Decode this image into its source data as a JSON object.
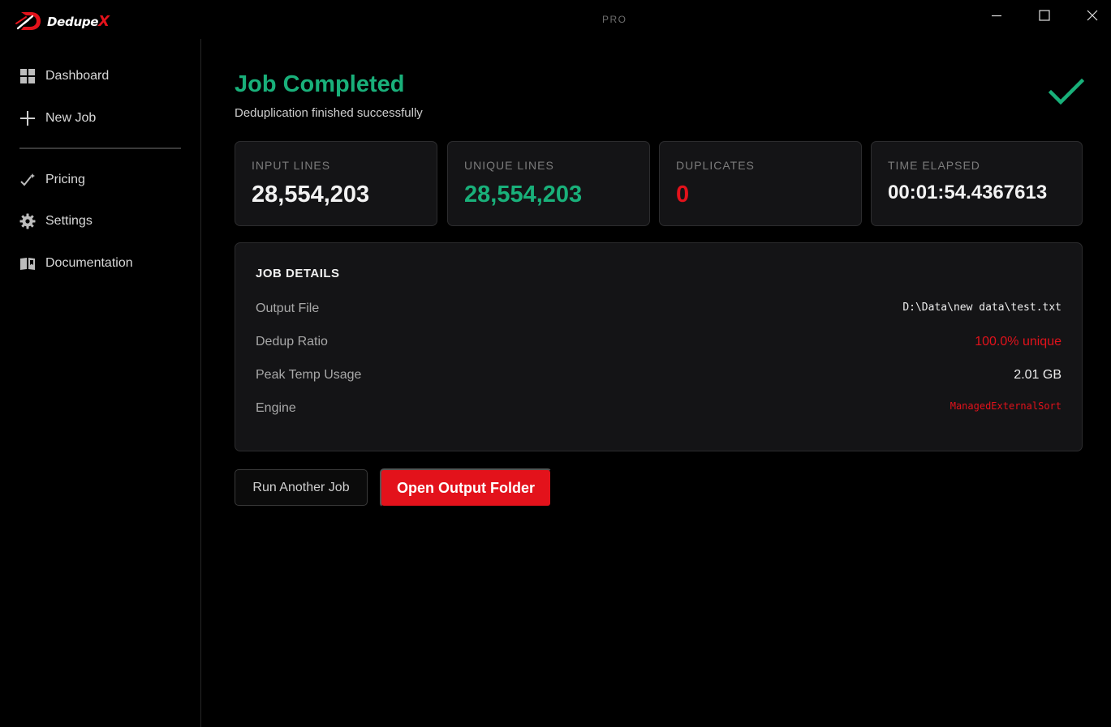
{
  "app": {
    "brand": "Dedupe",
    "brand_x": "X",
    "tier": "PRO"
  },
  "colors": {
    "accent": "#e3121b",
    "success": "#19b07a",
    "background": "#000000",
    "card": "#141416"
  },
  "window_controls": [
    "minimize-icon",
    "maximize-icon",
    "close-icon"
  ],
  "sidebar": {
    "items": [
      {
        "label": "Dashboard",
        "icon": "grid-icon"
      },
      {
        "label": "New Job",
        "icon": "plus-icon"
      },
      {
        "label": "Pricing",
        "icon": "check-sparkle-icon"
      },
      {
        "label": "Settings",
        "icon": "gear-icon"
      },
      {
        "label": "Documentation",
        "icon": "book-icon"
      }
    ]
  },
  "main": {
    "title": "Job Completed",
    "subtitle": "Deduplication finished successfully",
    "status_icon": "checkmark-icon",
    "stats": [
      {
        "label": "INPUT LINES",
        "value": "28,554,203",
        "color": "#f2f2f2"
      },
      {
        "label": "UNIQUE LINES",
        "value": "28,554,203",
        "color": "#19b07a"
      },
      {
        "label": "DUPLICATES",
        "value": "0",
        "color": "#e3121b"
      },
      {
        "label": "TIME ELAPSED",
        "value": "00:01:54.4367613",
        "color": "#f2f2f2"
      }
    ],
    "details": {
      "title": "JOB DETAILS",
      "rows": [
        {
          "key": "Output File",
          "value": "D:\\Data\\new data\\test.txt"
        },
        {
          "key": "Dedup Ratio",
          "value": "100.0% unique"
        },
        {
          "key": "Peak Temp Usage",
          "value": "2.01 GB"
        },
        {
          "key": "Engine",
          "value": "ManagedExternalSort"
        }
      ]
    },
    "actions": {
      "run_another": "Run Another Job",
      "open_folder": "Open Output Folder"
    }
  }
}
